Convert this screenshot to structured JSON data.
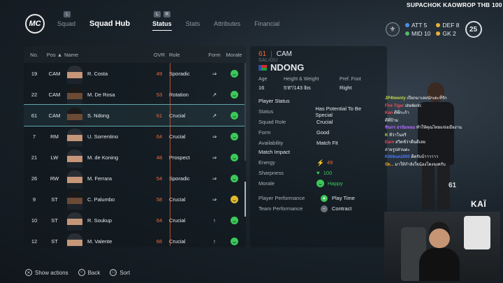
{
  "logo": "MC",
  "nav": {
    "squad": "Squad",
    "hub": "Squad Hub",
    "status": "Status",
    "stats": "Stats",
    "attributes": "Attributes",
    "financial": "Financial"
  },
  "stream": {
    "title": "SUPACHOK KAOWROP  THB 100",
    "watermark": "KAÏ"
  },
  "summary": {
    "att": "ATT 5",
    "def": "DEF 8",
    "mid": "MID 10",
    "gk": "GK  2",
    "total": "25"
  },
  "table": {
    "headers": {
      "no": "No.",
      "pos": "Pos ▲",
      "name": "Name",
      "ovr": "OVR",
      "role": "Role",
      "form": "Form",
      "morale": "Morale"
    },
    "rows": [
      {
        "no": "19",
        "pos": "CAM",
        "name": "R. Costa",
        "ovr": "49",
        "role": "Sporadic",
        "form": "⇒",
        "morale": "happy"
      },
      {
        "no": "22",
        "pos": "CAM",
        "name": "M. De Rosa",
        "ovr": "53",
        "role": "Rotation",
        "form": "↗",
        "morale": "happy"
      },
      {
        "no": "61",
        "pos": "CAM",
        "name": "S. Ndong",
        "ovr": "61",
        "role": "Crucial",
        "form": "↗",
        "morale": "happy"
      },
      {
        "no": "7",
        "pos": "RM",
        "name": "U. Sorrentino",
        "ovr": "64",
        "role": "Crucial",
        "form": "⇒",
        "morale": "happy"
      },
      {
        "no": "21",
        "pos": "LW",
        "name": "M. de Koning",
        "ovr": "48",
        "role": "Prospect",
        "form": "⇒",
        "morale": "happy"
      },
      {
        "no": "26",
        "pos": "RW",
        "name": "M. Ferrara",
        "ovr": "54",
        "role": "Sporadic",
        "form": "⇒",
        "morale": "happy"
      },
      {
        "no": "9",
        "pos": "ST",
        "name": "C. Palumbo",
        "ovr": "58",
        "role": "Crucial",
        "form": "⇒",
        "morale": "neutral"
      },
      {
        "no": "10",
        "pos": "ST",
        "name": "R. Soukup",
        "ovr": "64",
        "role": "Crucial",
        "form": "↑",
        "morale": "happy"
      },
      {
        "no": "12",
        "pos": "ST",
        "name": "M. Valente",
        "ovr": "66",
        "role": "Crucial",
        "form": "↑",
        "morale": "happy"
      }
    ]
  },
  "detail": {
    "ovr": "61",
    "sep": "|",
    "pos": "CAM",
    "first": "SALIOU",
    "last": "NDONG",
    "age_label": "Age",
    "age": "16",
    "hw_label": "Height & Weight",
    "hw": "5'8\"/143 lbs",
    "foot_label": "Pref. Foot",
    "foot": "Right",
    "player_status": "Player Status",
    "status_label": "Status",
    "status": "Has Potential To Be Special",
    "role_label": "Squad Role",
    "role": "Crucial",
    "form_label": "Form",
    "form": "Good",
    "avail_label": "Availability",
    "avail": "Match Fit",
    "impact": "Match Impact",
    "energy_label": "Energy",
    "energy": "49",
    "sharp_label": "Sharpness",
    "sharp": "100",
    "morale_label": "Morale",
    "morale": "Happy",
    "pp_label": "Player Performance",
    "playtime": "Play Time",
    "tp_label": "Team Performance",
    "contract": "Contract"
  },
  "bottom": {
    "show": "Show actions",
    "back": "Back",
    "sort": "Sort"
  },
  "chat": [
    {
      "user": "JP4twenty",
      "msg": "เปียกมาเลยนักเตะที่รัก"
    },
    {
      "user": "Fire Tiger",
      "msg": "shellerin:"
    },
    {
      "user": "Kan",
      "msg": "ดีพี่กะก้า"
    },
    {
      "user": "",
      "msg": "ดีพี่ป้าม"
    },
    {
      "user": "ชินกร ธรนัมหอม",
      "msg": "ทำให้คุณไทยแข่งเมืองาน"
    },
    {
      "user": "K",
      "msg": "ทีว่าโนจริ"
    },
    {
      "user": "Earn",
      "msg": "สวิตช์ว่าดีนดีเลย"
    },
    {
      "user": "",
      "msg": "ถ่ายรูปส่วนตะ"
    },
    {
      "user": "Kittikun2000",
      "msg": "ดีครับบ้าาาาาา"
    },
    {
      "user": "บัด...",
      "msg": "มาให้กำลังใจน้องโดงจงครับ"
    }
  ]
}
